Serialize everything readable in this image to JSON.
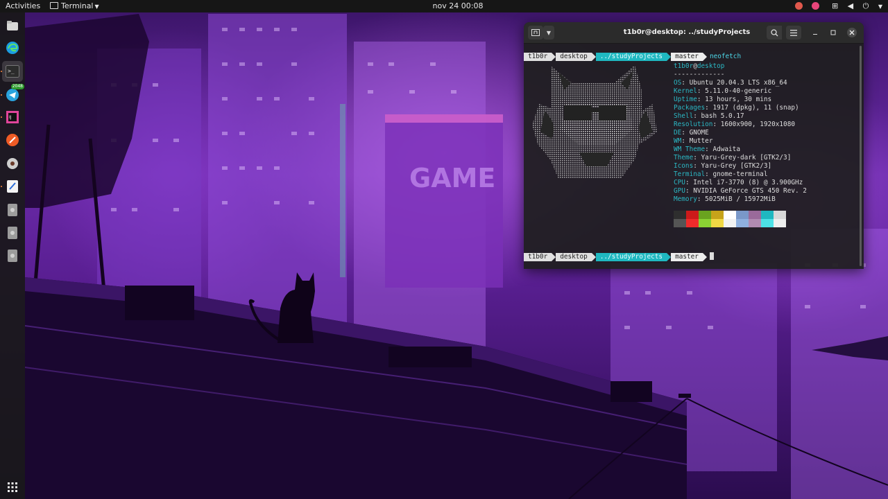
{
  "topbar": {
    "activities": "Activities",
    "app_menu": "Terminal",
    "clock": "nov 24  00:08",
    "tray_colors": {
      "chrome": "#e0584c",
      "app": "#e8457a"
    }
  },
  "dock": {
    "items": [
      {
        "name": "files",
        "icon": "folder-icon",
        "color": "#d8d8d8"
      },
      {
        "name": "edge",
        "icon": "edge-icon",
        "color": "#1b9de2"
      },
      {
        "name": "terminal",
        "icon": "terminal-icon",
        "color": "#2c2c2c"
      },
      {
        "name": "telegram",
        "icon": "telegram-icon",
        "color": "#2aa3dd",
        "badge": "2048"
      },
      {
        "name": "jetbrains",
        "icon": "jetbrains-icon",
        "color": "#e0459a"
      },
      {
        "name": "postman",
        "icon": "postman-icon",
        "color": "#ef5b25"
      },
      {
        "name": "disk",
        "icon": "disk-icon",
        "color": "#cfcfcf"
      },
      {
        "name": "text-editor",
        "icon": "text-editor-icon",
        "color": "#f4f4f4"
      },
      {
        "name": "drive-1",
        "icon": "drive-icon",
        "color": "#9c9c9c"
      },
      {
        "name": "drive-2",
        "icon": "drive-icon",
        "color": "#9c9c9c"
      },
      {
        "name": "drive-3",
        "icon": "drive-icon",
        "color": "#9c9c9c"
      }
    ],
    "grid_icon": "app-grid-icon"
  },
  "terminal": {
    "title": "t1b0r@desktop: ../studyProjects",
    "prompt": {
      "user": "t1b0r",
      "host": "desktop",
      "dir": "../studyProjects",
      "branch": "master"
    },
    "command": "neofetch",
    "user_at_host": {
      "user": "t1b0r",
      "at": "@",
      "host": "desktop"
    },
    "separator": "-------------",
    "info": [
      {
        "key": "OS",
        "value": "Ubuntu 20.04.3 LTS x86_64"
      },
      {
        "key": "Kernel",
        "value": "5.11.0-40-generic"
      },
      {
        "key": "Uptime",
        "value": "13 hours, 30 mins"
      },
      {
        "key": "Packages",
        "value": "1917 (dpkg), 11 (snap)"
      },
      {
        "key": "Shell",
        "value": "bash 5.0.17"
      },
      {
        "key": "Resolution",
        "value": "1600x900, 1920x1080"
      },
      {
        "key": "DE",
        "value": "GNOME"
      },
      {
        "key": "WM",
        "value": "Mutter"
      },
      {
        "key": "WM Theme",
        "value": "Adwaita"
      },
      {
        "key": "Theme",
        "value": "Yaru-Grey-dark [GTK2/3]"
      },
      {
        "key": "Icons",
        "value": "Yaru-Grey [GTK2/3]"
      },
      {
        "key": "Terminal",
        "value": "gnome-terminal"
      },
      {
        "key": "CPU",
        "value": "Intel i7-3770 (8) @ 3.900GHz"
      },
      {
        "key": "GPU",
        "value": "NVIDIA GeForce GTS 450 Rev. 2"
      },
      {
        "key": "Memory",
        "value": "5025MiB / 15972MiB"
      }
    ],
    "palette_top": [
      "#2e2e2e",
      "#cc1a1a",
      "#6aa31f",
      "#c7a31a",
      "#ffffff",
      "#7a98c9",
      "#9a6a9a",
      "#1fb8c0",
      "#d8d8d8"
    ],
    "palette_bottom": [
      "#555555",
      "#ee2b2b",
      "#8ad233",
      "#f0d744",
      "#f2f2f2",
      "#8fb0df",
      "#b18bb1",
      "#4de1e6",
      "#eeeeee"
    ]
  }
}
